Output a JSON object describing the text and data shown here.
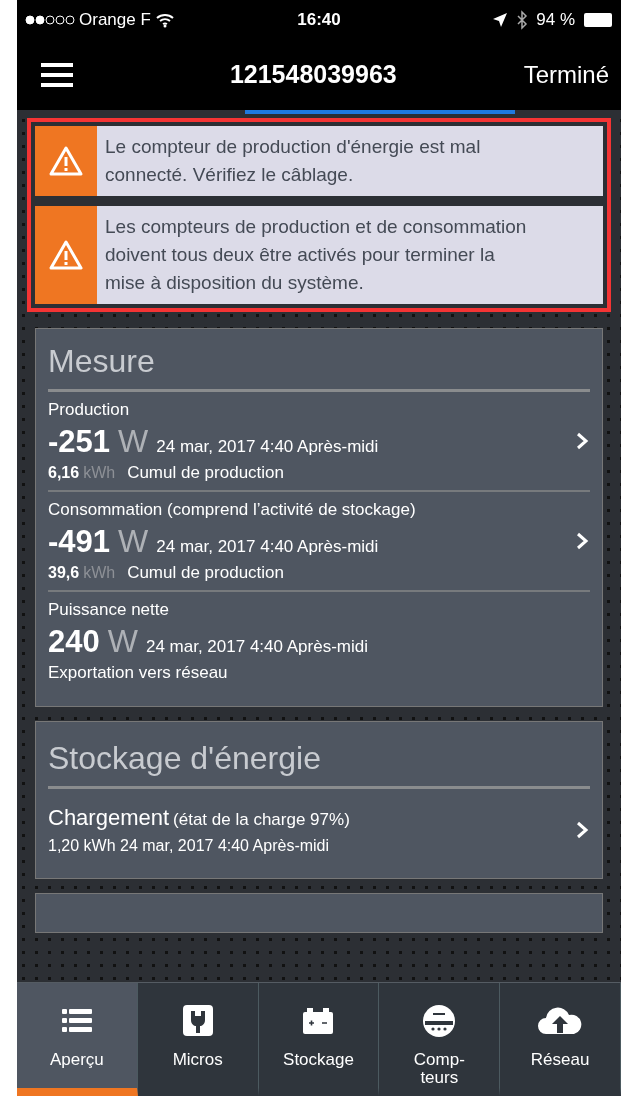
{
  "status_bar": {
    "carrier": "Orange F",
    "time": "16:40",
    "battery": "94 %"
  },
  "nav": {
    "title": "121548039963",
    "done": "Terminé"
  },
  "alerts": [
    {
      "text": "Le compteur de production d'énergie est mal connecté. Vérifiez le câblage."
    },
    {
      "text": "Les compteurs de production et de consommation doivent tous deux être activés pour terminer la mise à disposition du système."
    }
  ],
  "mesure": {
    "title": "Mesure",
    "rows": [
      {
        "label": "Production",
        "value": "-251",
        "unit": "W",
        "time": "24 mar, 2017 4:40 Après-midi",
        "total": "6,16",
        "total_unit": "kWh",
        "note": "Cumul de production",
        "link": true
      },
      {
        "label": "Consommation (comprend l’activité de stockage)",
        "value": "-491",
        "unit": "W",
        "time": "24 mar, 2017 4:40 Après-midi",
        "total": "39,6",
        "total_unit": "kWh",
        "note": "Cumul de production",
        "link": true
      },
      {
        "label": "Puissance nette",
        "value": "240",
        "unit": "W",
        "time": "24 mar, 2017 4:40 Après-midi",
        "note": "Exportation vers réseau",
        "link": false
      }
    ]
  },
  "stockage": {
    "title": "Stockage d'énergie",
    "state": "Chargement",
    "detail": "(état de la charge 97%)",
    "line": "1,20 kWh 24 mar, 2017 4:40 Après-midi"
  },
  "tabs": [
    {
      "kind": "list",
      "label": "Aperçu",
      "selected": true
    },
    {
      "kind": "plug",
      "label": "Micros",
      "selected": false
    },
    {
      "kind": "battery",
      "label": "Stockage",
      "selected": false
    },
    {
      "kind": "meter",
      "label": "Comp-\nteurs",
      "selected": false
    },
    {
      "kind": "cloud",
      "label": "Réseau",
      "selected": false
    }
  ]
}
